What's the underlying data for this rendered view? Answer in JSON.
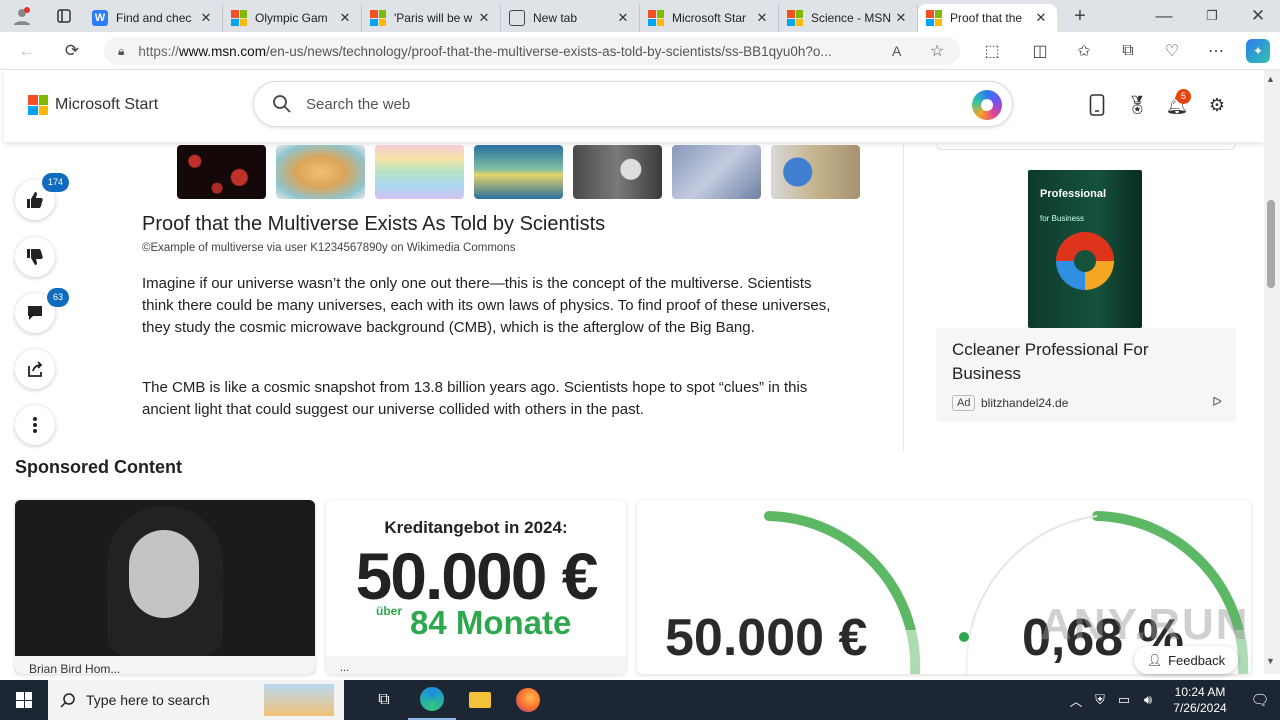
{
  "browser": {
    "tabs": [
      {
        "title": "Find and chec",
        "favicon_color": "#2f7df6",
        "active": false
      },
      {
        "title": "Olympic Gam",
        "favicon_color": "#f25022",
        "active": false
      },
      {
        "title": "'Paris will be w",
        "favicon_color": "#f25022",
        "active": false
      },
      {
        "title": "New tab",
        "favicon_color": "#444444",
        "active": false
      },
      {
        "title": "Microsoft Star",
        "favicon_color": "#f25022",
        "active": false
      },
      {
        "title": "Science - MSN",
        "favicon_color": "#f25022",
        "active": false
      },
      {
        "title": "Proof that the",
        "favicon_color": "#f25022",
        "active": true
      }
    ],
    "url": {
      "prefix": "https://",
      "host": "www.msn.com",
      "path": "/en-us/news/technology/proof-that-the-multiverse-exists-as-told-by-scientists/ss-BB1qyu0h?o..."
    }
  },
  "msn": {
    "brand": "Microsoft Start",
    "search_placeholder": "Search the web",
    "notifications_count": "5"
  },
  "rail": {
    "likes": "174",
    "comments": "63"
  },
  "article": {
    "title": "Proof that the Multiverse Exists As Told by Scientists",
    "credit": "©Example of multiverse via user K1234567890y on Wikimedia Commons",
    "paragraphs": [
      "Imagine if our universe wasn’t the only one out there—this is the concept of the multiverse. Scientists think there could be many universes, each with its own laws of physics. To find proof of these universes, they study the cosmic microwave background (CMB), which is the afterglow of the Big Bang.",
      "The CMB is like a cosmic snapshot from 13.8 billion years ago. Scientists hope to spot “clues” in this ancient light that could suggest our universe collided with others in the past."
    ]
  },
  "ad": {
    "product_title": "Professional",
    "product_subtitle": "for Business",
    "title": "Ccleaner Professional For Business",
    "label": "Ad",
    "source": "blitzhandel24.de"
  },
  "sponsored": {
    "heading": "Sponsored Content",
    "card1_source": "Brian Bird Hom...",
    "card2_line1": "Kreditangebot in 2024:",
    "card2_amount": "50.000 €",
    "card2_over": "über",
    "card2_months": "84 Monate",
    "card2_source": "...",
    "card3_amount": "50.000 €",
    "card3_rate": "0,68 %"
  },
  "watermark": "ANY.RUN",
  "feedback": "Feedback",
  "taskbar": {
    "search_placeholder": "Type here to search",
    "time": "10:24 AM",
    "date": "7/26/2024"
  }
}
